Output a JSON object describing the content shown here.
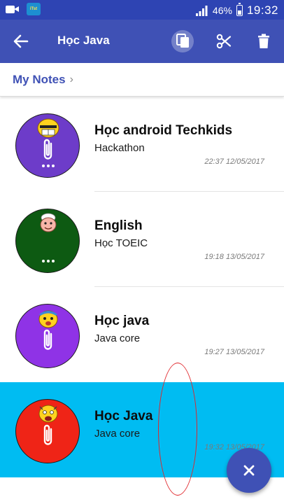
{
  "status_bar": {
    "battery": "46%",
    "time": "19:32",
    "icons": [
      "video-camera-icon",
      "app-notification-icon",
      "signal-icon",
      "battery-icon"
    ]
  },
  "toolbar": {
    "title": "Học Java",
    "icons": [
      "back-arrow-icon",
      "copy-icon",
      "scissors-icon",
      "trash-icon"
    ]
  },
  "breadcrumb": {
    "label": "My Notes",
    "chevron": "›"
  },
  "notes": [
    {
      "title": "Học android Techkids",
      "subtitle": "Hackathon",
      "timestamp": "22:37 12/05/2017",
      "color": "#6d3cc9",
      "has_more": true,
      "selected": false
    },
    {
      "title": "English",
      "subtitle": "Học TOEIC",
      "timestamp": "19:18 13/05/2017",
      "color": "#0d5a12",
      "has_more": true,
      "selected": false
    },
    {
      "title": "Học java",
      "subtitle": "Java core",
      "timestamp": "19:27 13/05/2017",
      "color": "#8f33e6",
      "has_more": false,
      "selected": false
    },
    {
      "title": "Học Java",
      "subtitle": "Java core",
      "timestamp": "19:32 13/05/2017",
      "color": "#ef2417",
      "has_more": false,
      "selected": true
    }
  ],
  "fab": {
    "icon": "close-icon"
  },
  "colors": {
    "status_bar": "#2e44b3",
    "toolbar": "#3f51b5",
    "accent": "#3f51b5",
    "selected_row": "#00bcf2",
    "annotation": "#e0262b"
  }
}
